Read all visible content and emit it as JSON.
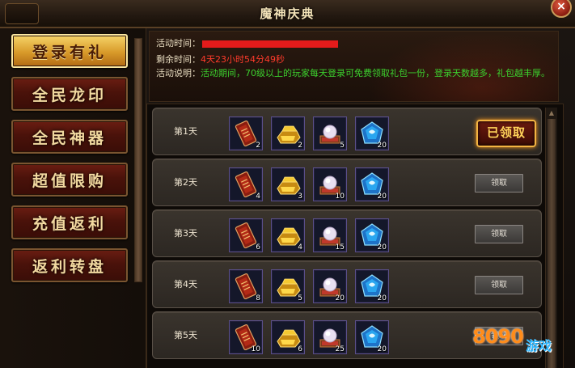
{
  "window": {
    "title": "魔神庆典",
    "close_glyph": "×"
  },
  "sidebar": {
    "items": [
      {
        "label": "登录有礼",
        "active": true
      },
      {
        "label": "全民龙印",
        "active": false
      },
      {
        "label": "全民神器",
        "active": false
      },
      {
        "label": "超值限购",
        "active": false
      },
      {
        "label": "充值返利",
        "active": false
      },
      {
        "label": "返利转盘",
        "active": false
      }
    ]
  },
  "info": {
    "time_label": "活动时间：",
    "remaining_label": "剩余时间：",
    "remaining_value": "4天23小时54分49秒",
    "desc_label": "活动说明：",
    "desc_value": "活动期间，70级以上的玩家每天登录可免费领取礼包一份，登录天数越多，礼包越丰厚。"
  },
  "rewards": {
    "rows": [
      {
        "day": "第1天",
        "counts": [
          "2",
          "2",
          "5",
          "20"
        ],
        "status": "已领取"
      },
      {
        "day": "第2天",
        "counts": [
          "4",
          "3",
          "10",
          "20"
        ],
        "status": "领取"
      },
      {
        "day": "第3天",
        "counts": [
          "6",
          "4",
          "15",
          "20"
        ],
        "status": "领取"
      },
      {
        "day": "第4天",
        "counts": [
          "8",
          "5",
          "20",
          "20"
        ],
        "status": "领取"
      },
      {
        "day": "第5天",
        "counts": [
          "10",
          "6",
          "25",
          "20"
        ],
        "status": "领取"
      }
    ],
    "item_icons": [
      "red-card-icon",
      "gold-ingot-icon",
      "pearl-icon",
      "blue-crystal-icon"
    ]
  },
  "watermark": {
    "brand": "8090",
    "suffix": "游戏"
  },
  "colors": {
    "accent_red": "#e41b1b",
    "desc_green": "#3cd12e",
    "gold": "#f6d468"
  }
}
